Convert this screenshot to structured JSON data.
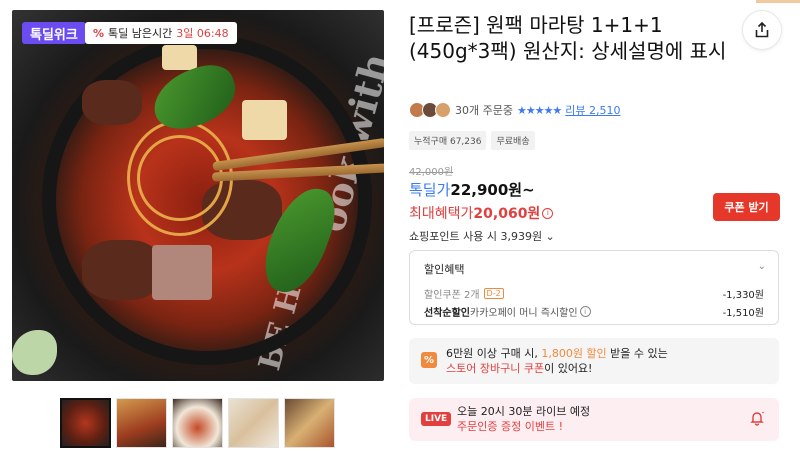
{
  "hero": {
    "badge_week": "톡딜위크",
    "timer_label": "톡딜 남은시간",
    "timer_value": "3일 06:48",
    "bg_text_1": "ook with",
    "bg_text_2": "BE H"
  },
  "product": {
    "title": "[프로즌] 원팩 마라탕 1+1+1 (450g*3팩) 원산지: 상세설명에 표시",
    "order_count": "30개 주문중",
    "stars": "★★★★★",
    "review_link": "리뷰 2,510",
    "tags": [
      "누적구매 67,236",
      "무료배송"
    ],
    "original_price": "42,000원",
    "price_label": "톡딜가",
    "price_value": "22,900원~",
    "max_label": "최대혜택가",
    "max_value": "20,060원",
    "coupon_button": "쿠폰 받기",
    "points": "쇼핑포인트 사용 시 3,939원 ⌄"
  },
  "discount": {
    "title": "할인혜택",
    "row1_label": "할인쿠폰 2개",
    "row1_badge": "D-2",
    "row1_amount": "-1,330원",
    "row2_label_bold": "선착순할인",
    "row2_label": " 카카오페이 머니 즉시할인",
    "row2_amount": "-1,510원"
  },
  "promo1": {
    "line1_a": "6만원 이상 구매 시, ",
    "line1_hl": "1,800원 할인",
    "line1_b": " 받을 수 있는",
    "line2_hl": "스토어 장바구니 쿠폰",
    "line2_b": "이 있어요!"
  },
  "promo2": {
    "badge": "LIVE",
    "line1": "오늘 20시 30분 라이브 예정",
    "line2": "주문인증 증정 이벤트 !"
  },
  "colors": {
    "accent_blue": "#3b7cf0",
    "accent_red": "#e23f3f",
    "accent_orange": "#f08a3e",
    "badge_purple": "#6a4cf0"
  }
}
